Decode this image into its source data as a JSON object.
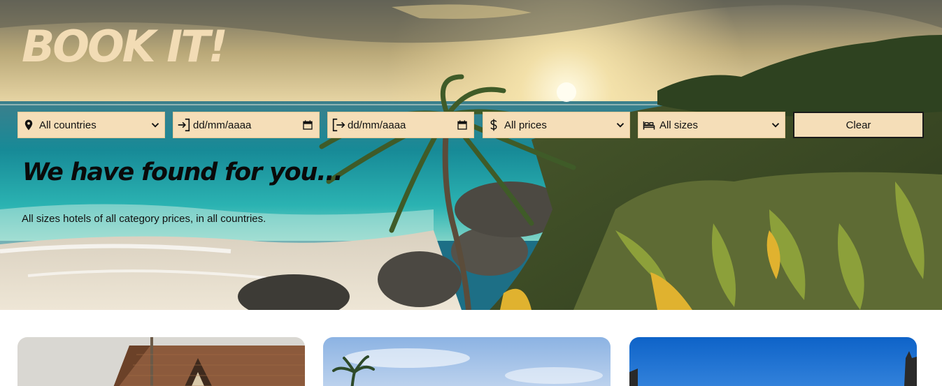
{
  "brand": {
    "title": "BOOK IT!"
  },
  "filters": {
    "country": {
      "value": "All countries",
      "icon": "map-pin-icon"
    },
    "check_in": {
      "value": "dd/mm/aaaa",
      "icon": "login-icon"
    },
    "check_out": {
      "value": "dd/mm/aaaa",
      "icon": "logout-icon"
    },
    "price": {
      "value": "All prices",
      "icon": "dollar-icon"
    },
    "size": {
      "value": "All sizes",
      "icon": "bed-icon"
    },
    "clear_label": "Clear"
  },
  "results": {
    "heading": "We have found for you...",
    "summary": "All sizes hotels of all category prices, in all countries."
  },
  "colors": {
    "filter_bg": "#f5deb8",
    "title_color": "#f2dcb5"
  }
}
